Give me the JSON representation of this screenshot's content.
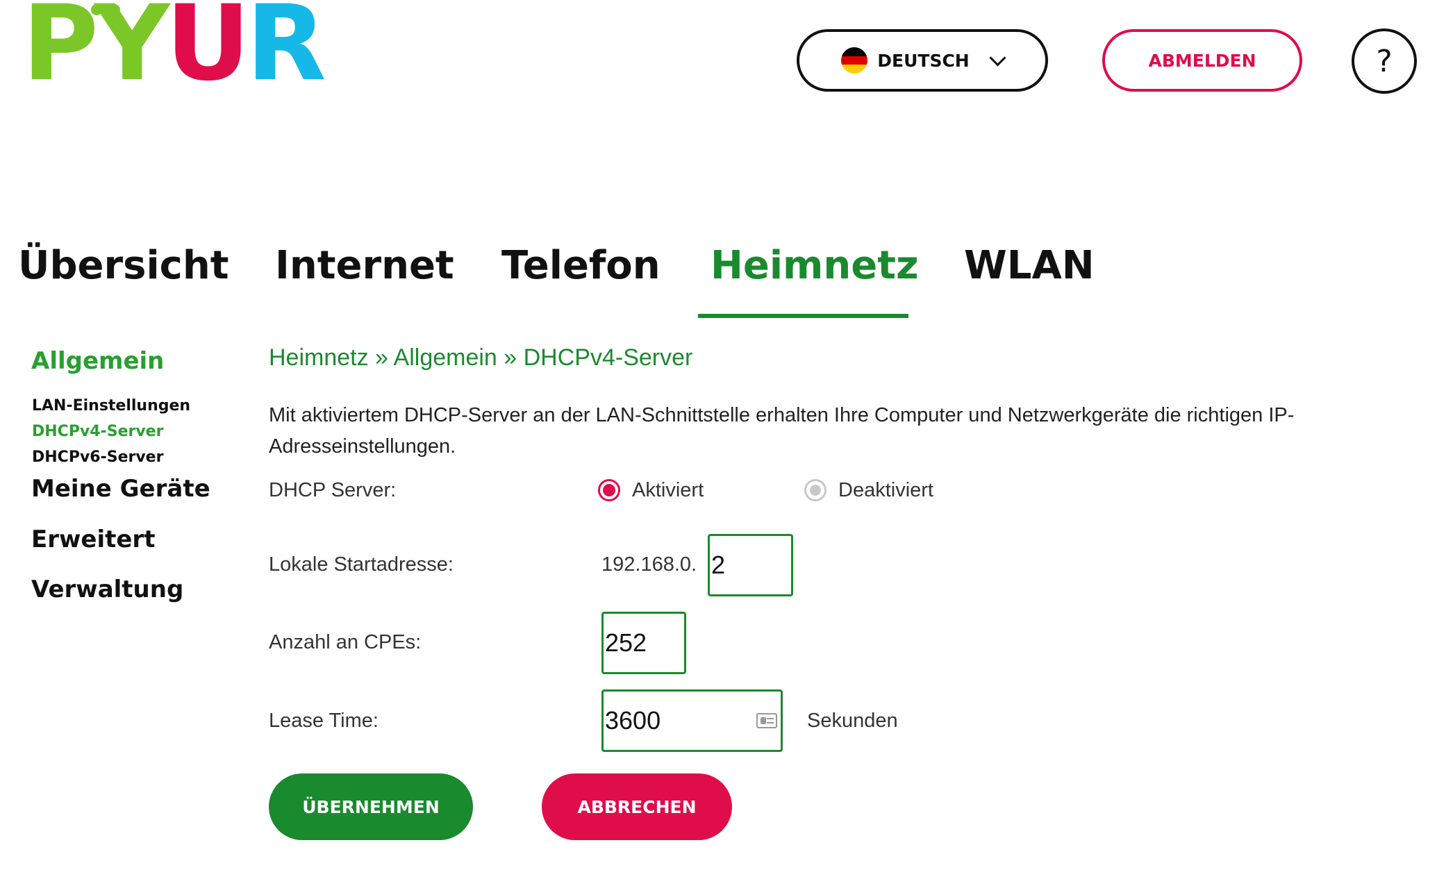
{
  "brand": {
    "letters": [
      "P",
      "Y",
      "U",
      "R"
    ],
    "colors": {
      "P": "#7cc728",
      "Y": "#7cc728",
      "U": "#e00d4b",
      "R": "#16b8e8"
    }
  },
  "header": {
    "language": {
      "label": "DEUTSCH",
      "flag": "germany-flag-icon"
    },
    "logout_label": "ABMELDEN",
    "help_label": "?"
  },
  "nav": {
    "tabs": [
      {
        "label": "Übersicht",
        "active": false
      },
      {
        "label": "Internet",
        "active": false
      },
      {
        "label": "Telefon",
        "active": false
      },
      {
        "label": "Heimnetz",
        "active": true
      },
      {
        "label": "WLAN",
        "active": false
      }
    ]
  },
  "sidebar": {
    "sections": [
      {
        "label": "Allgemein",
        "active": true
      },
      {
        "label": "Meine Geräte",
        "active": false
      },
      {
        "label": "Erweitert",
        "active": false
      },
      {
        "label": "Verwaltung",
        "active": false
      }
    ],
    "subitems": [
      {
        "label": "LAN-Einstellungen",
        "active": false
      },
      {
        "label": "DHCPv4-Server",
        "active": true
      },
      {
        "label": "DHCPv6-Server",
        "active": false
      }
    ]
  },
  "content": {
    "breadcrumb": "Heimnetz » Allgemein » DHCPv4-Server",
    "description": "Mit aktiviertem DHCP-Server an der LAN-Schnittstelle erhalten Ihre Computer und Netzwerkgeräte die richtigen IP-Adresseinstellungen.",
    "form": {
      "dhcp_label": "DHCP Server:",
      "option_on": "Aktiviert",
      "option_off": "Deaktiviert",
      "start_label": "Lokale Startadresse:",
      "start_prefix": "192.168.0.",
      "start_value": "2",
      "cpe_label": "Anzahl an CPEs:",
      "cpe_value": "252",
      "lease_label": "Lease Time:",
      "lease_value": "3600",
      "lease_unit": "Sekunden"
    },
    "buttons": {
      "apply": "ÜBERNEHMEN",
      "cancel": "ABBRECHEN"
    }
  },
  "colors": {
    "green": "#1a8a2e",
    "light_green": "#28a02f",
    "red": "#e00d4b",
    "blue": "#16b8e8"
  }
}
